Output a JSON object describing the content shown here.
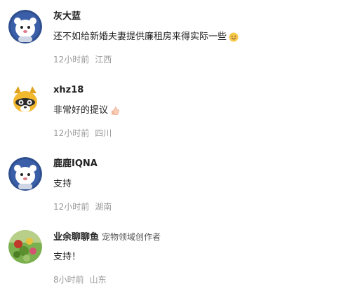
{
  "comments": [
    {
      "username": "灰大蓝",
      "content": "还不如给新婚夫妻提供廉租房来得实际一些",
      "emoji": "smiling-face-icon",
      "time": "12小时前",
      "location": "江西"
    },
    {
      "username": "xhz18",
      "content": "非常好的提议",
      "emoji": "thumbs-up-icon",
      "time": "12小时前",
      "location": "四川"
    },
    {
      "username": "鹿鹿IQNA",
      "content": "支持",
      "time": "12小时前",
      "location": "湖南"
    },
    {
      "username": "业余聊聊鱼",
      "tag": "宠物领域创作者",
      "content": "支持！",
      "time": "8小时前",
      "location": "山东"
    }
  ]
}
